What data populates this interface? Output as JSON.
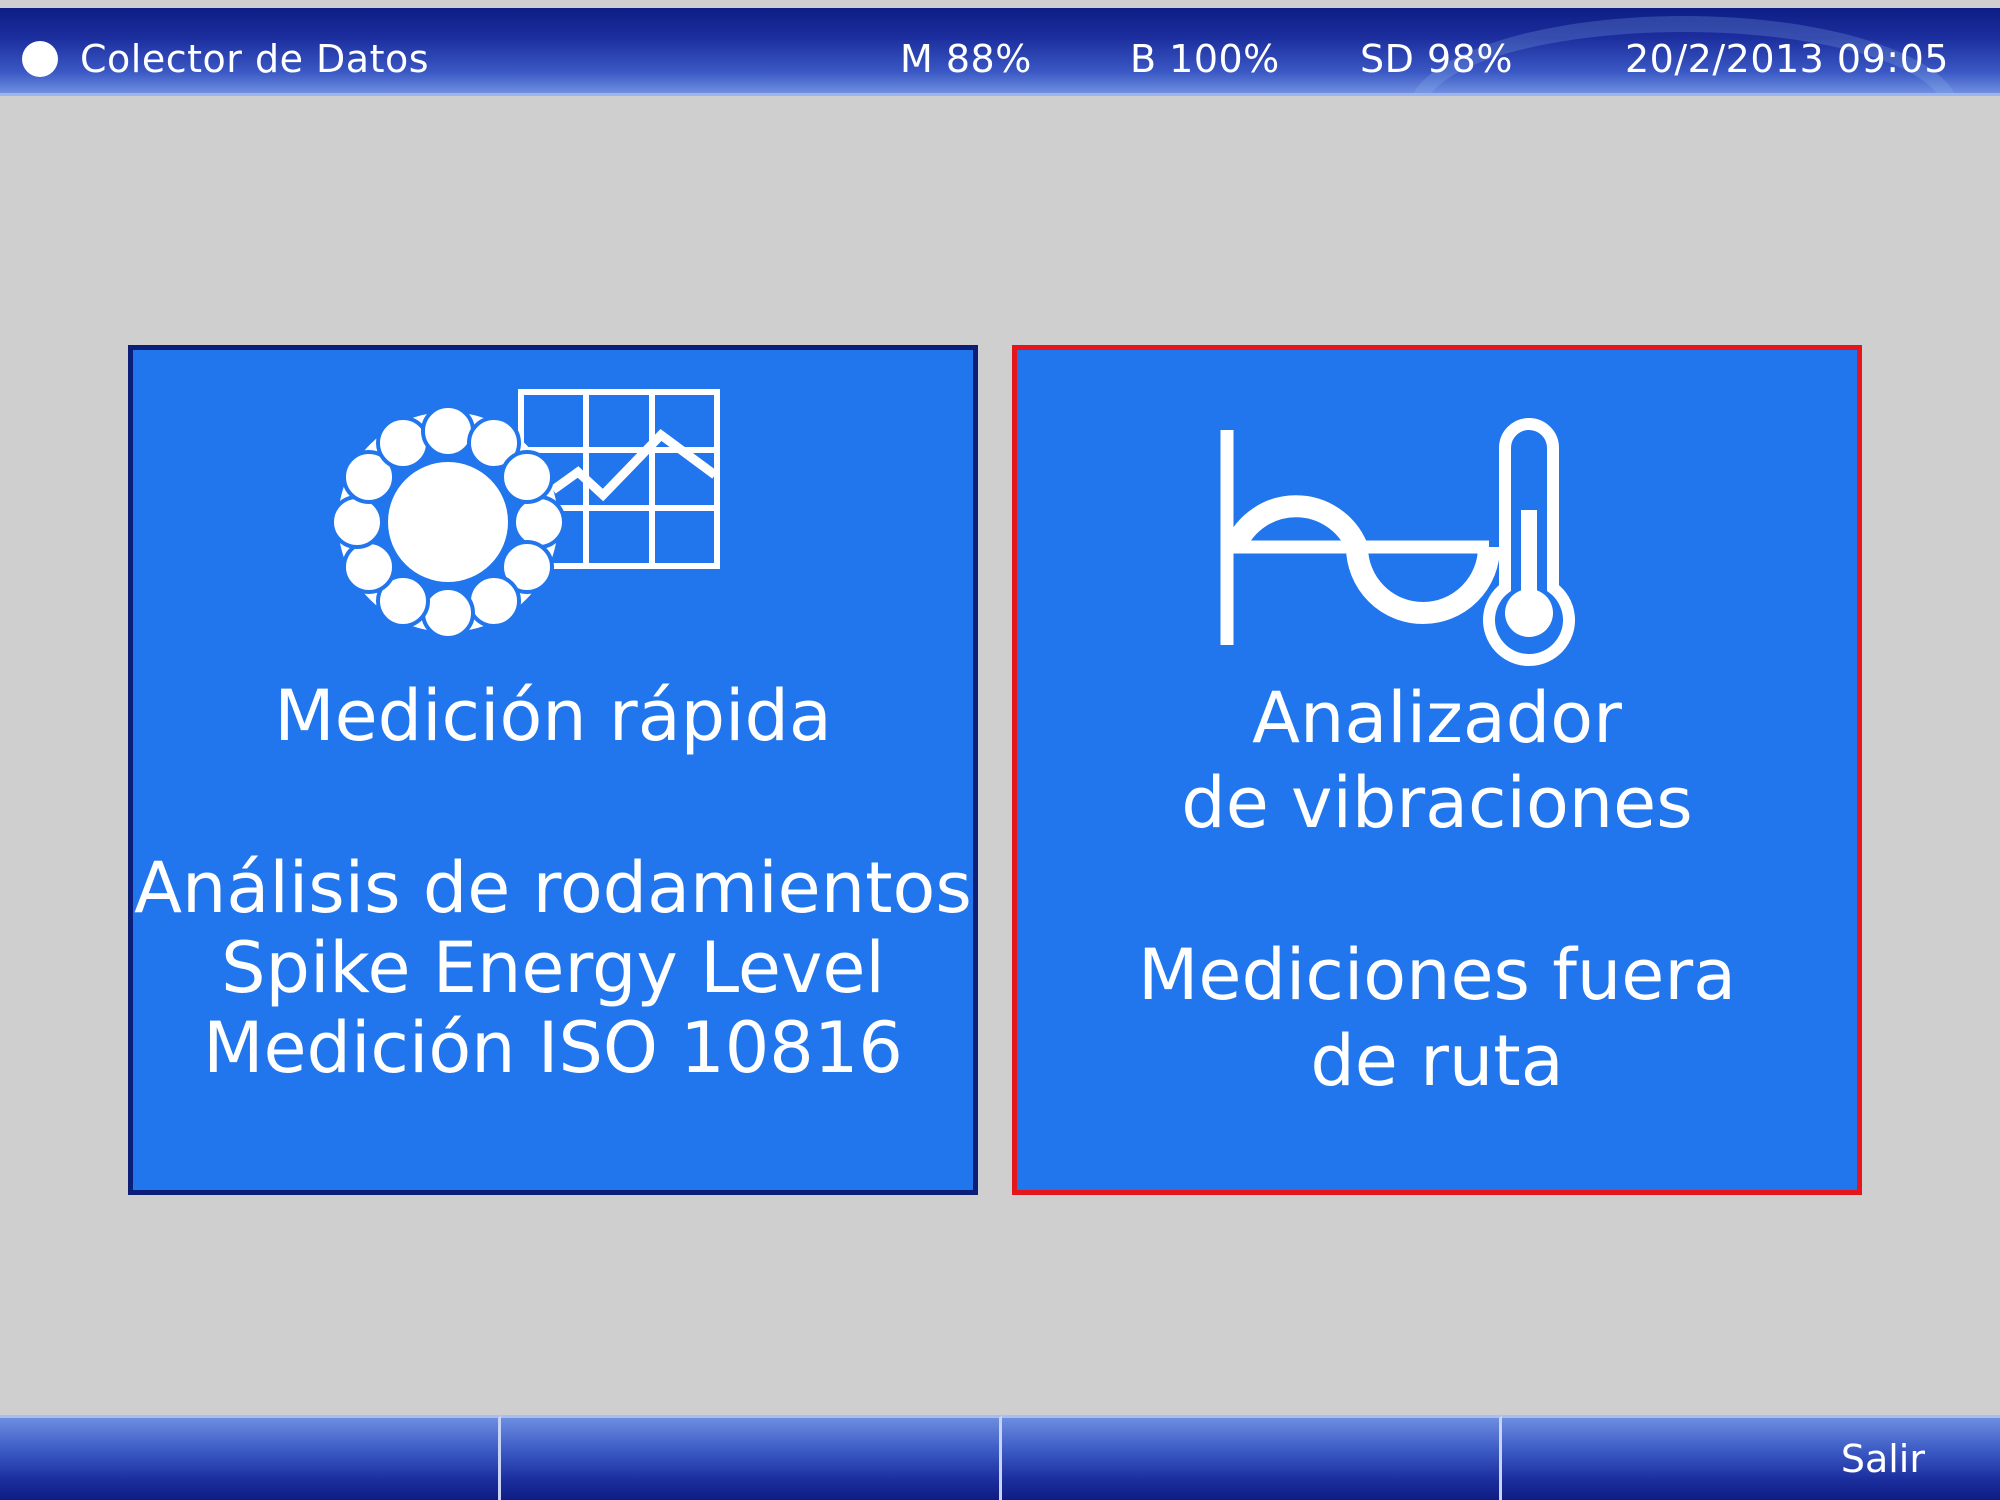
{
  "status_bar": {
    "title": "Colector de Datos",
    "memory": "M 88%",
    "battery": "B 100%",
    "sd_card": "SD 98%",
    "datetime": "20/2/2013 09:05"
  },
  "tiles": {
    "quick_measurement": {
      "icon": "bearing-chart-icon",
      "title": "Medición rápida",
      "lines": [
        "Análisis de rodamientos",
        "Spike Energy Level",
        "Medición ISO 10816"
      ]
    },
    "vibration_analyzer": {
      "icon": "vibration-thermometer-icon",
      "title_line1": "Analizador",
      "title_line2": "de vibraciones",
      "lines": [
        "Mediciones fuera",
        "de ruta"
      ],
      "selected": true
    }
  },
  "softkeys": [
    {
      "label": ""
    },
    {
      "label": ""
    },
    {
      "label": ""
    },
    {
      "label": "Salir"
    }
  ],
  "colors": {
    "background": "#cfcfcf",
    "tile_fill": "#2176ee",
    "tile_border": "#0b1f78",
    "selected_border": "#e4161c",
    "bar_dark": "#0e1d85",
    "text": "#ffffff"
  }
}
